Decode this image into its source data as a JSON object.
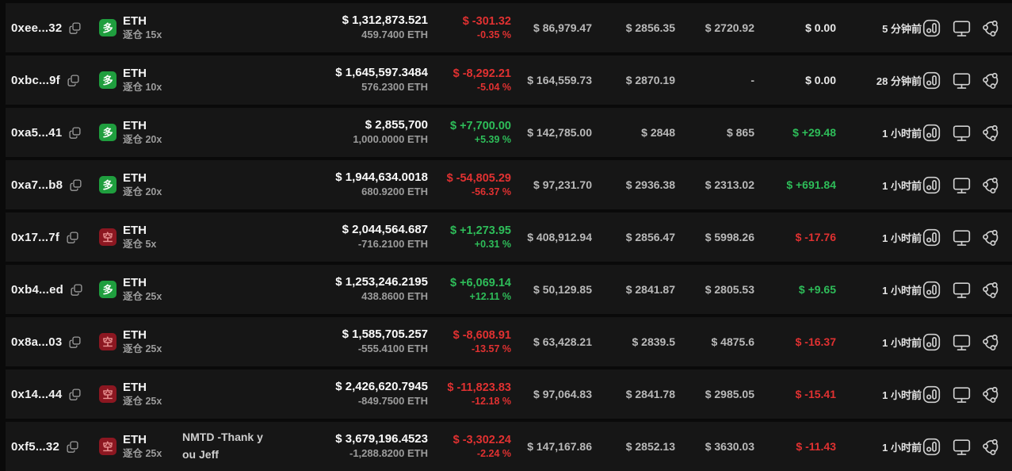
{
  "colors": {
    "green": "#2ebd59",
    "red": "#e03131",
    "badge_long_bg": "#1f9e3e",
    "badge_short_bg": "#8c1721",
    "badge_short_fg": "#e89090"
  },
  "directions": {
    "long": "多",
    "short": "空"
  },
  "icons": {
    "copy": "copy-icon",
    "chart": "chart-icon",
    "monitor": "monitor-icon",
    "share": "share-icon"
  },
  "table": {
    "rows": [
      {
        "address": "0xee...32",
        "direction": "long",
        "coin": "ETH",
        "margin_mode": "逐仓 15x",
        "note": "",
        "value_usd": "$ 1,312,873.521",
        "size": "459.7400 ETH",
        "pnl": "$ -301.32",
        "pnl_pct": "-0.35 %",
        "pnl_sign": "neg",
        "margin": "$ 86,979.47",
        "entry": "$ 2856.35",
        "liq": "$ 2720.92",
        "funding": "$ 0.00",
        "funding_sign": "neutral",
        "time": "5 分钟前"
      },
      {
        "address": "0xbc...9f",
        "direction": "long",
        "coin": "ETH",
        "margin_mode": "逐仓 10x",
        "note": "",
        "value_usd": "$ 1,645,597.3484",
        "size": "576.2300 ETH",
        "pnl": "$ -8,292.21",
        "pnl_pct": "-5.04 %",
        "pnl_sign": "neg",
        "margin": "$ 164,559.73",
        "entry": "$ 2870.19",
        "liq": "-",
        "funding": "$ 0.00",
        "funding_sign": "neutral",
        "time": "28 分钟前"
      },
      {
        "address": "0xa5...41",
        "direction": "long",
        "coin": "ETH",
        "margin_mode": "逐仓 20x",
        "note": "",
        "value_usd": "$ 2,855,700",
        "size": "1,000.0000 ETH",
        "pnl": "$ +7,700.00",
        "pnl_pct": "+5.39 %",
        "pnl_sign": "pos",
        "margin": "$ 142,785.00",
        "entry": "$ 2848",
        "liq": "$ 865",
        "funding": "$ +29.48",
        "funding_sign": "pos",
        "time": "1 小时前"
      },
      {
        "address": "0xa7...b8",
        "direction": "long",
        "coin": "ETH",
        "margin_mode": "逐仓 20x",
        "note": "",
        "value_usd": "$ 1,944,634.0018",
        "size": "680.9200 ETH",
        "pnl": "$ -54,805.29",
        "pnl_pct": "-56.37 %",
        "pnl_sign": "neg",
        "margin": "$ 97,231.70",
        "entry": "$ 2936.38",
        "liq": "$ 2313.02",
        "funding": "$ +691.84",
        "funding_sign": "pos",
        "time": "1 小时前"
      },
      {
        "address": "0x17...7f",
        "direction": "short",
        "coin": "ETH",
        "margin_mode": "逐仓 5x",
        "note": "",
        "value_usd": "$ 2,044,564.687",
        "size": "-716.2100 ETH",
        "pnl": "$ +1,273.95",
        "pnl_pct": "+0.31 %",
        "pnl_sign": "pos",
        "margin": "$ 408,912.94",
        "entry": "$ 2856.47",
        "liq": "$ 5998.26",
        "funding": "$ -17.76",
        "funding_sign": "neg",
        "time": "1 小时前"
      },
      {
        "address": "0xb4...ed",
        "direction": "long",
        "coin": "ETH",
        "margin_mode": "逐仓 25x",
        "note": "",
        "value_usd": "$ 1,253,246.2195",
        "size": "438.8600 ETH",
        "pnl": "$ +6,069.14",
        "pnl_pct": "+12.11 %",
        "pnl_sign": "pos",
        "margin": "$ 50,129.85",
        "entry": "$ 2841.87",
        "liq": "$ 2805.53",
        "funding": "$ +9.65",
        "funding_sign": "pos",
        "time": "1 小时前"
      },
      {
        "address": "0x8a...03",
        "direction": "short",
        "coin": "ETH",
        "margin_mode": "逐仓 25x",
        "note": "",
        "value_usd": "$ 1,585,705.257",
        "size": "-555.4100 ETH",
        "pnl": "$ -8,608.91",
        "pnl_pct": "-13.57 %",
        "pnl_sign": "neg",
        "margin": "$ 63,428.21",
        "entry": "$ 2839.5",
        "liq": "$ 4875.6",
        "funding": "$ -16.37",
        "funding_sign": "neg",
        "time": "1 小时前"
      },
      {
        "address": "0x14...44",
        "direction": "short",
        "coin": "ETH",
        "margin_mode": "逐仓 25x",
        "note": "",
        "value_usd": "$ 2,426,620.7945",
        "size": "-849.7500 ETH",
        "pnl": "$ -11,823.83",
        "pnl_pct": "-12.18 %",
        "pnl_sign": "neg",
        "margin": "$ 97,064.83",
        "entry": "$ 2841.78",
        "liq": "$ 2985.05",
        "funding": "$ -15.41",
        "funding_sign": "neg",
        "time": "1 小时前"
      },
      {
        "address": "0xf5...32",
        "direction": "short",
        "coin": "ETH",
        "margin_mode": "逐仓 25x",
        "note": "NMTD -Thank you Jeff",
        "value_usd": "$ 3,679,196.4523",
        "size": "-1,288.8200 ETH",
        "pnl": "$ -3,302.24",
        "pnl_pct": "-2.24 %",
        "pnl_sign": "neg",
        "margin": "$ 147,167.86",
        "entry": "$ 2852.13",
        "liq": "$ 3630.03",
        "funding": "$ -11.43",
        "funding_sign": "neg",
        "time": "1 小时前"
      }
    ]
  }
}
